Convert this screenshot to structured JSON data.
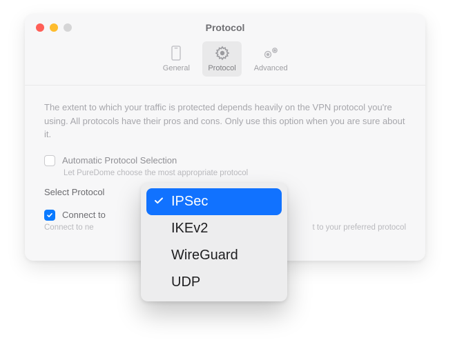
{
  "window": {
    "title": "Protocol"
  },
  "toolbar": {
    "items": [
      {
        "label": "General"
      },
      {
        "label": "Protocol"
      },
      {
        "label": "Advanced"
      }
    ],
    "selectedIndex": 1
  },
  "content": {
    "description": "The extent to which your traffic is protected depends heavily on the VPN protocol you're using. All protocols have their pros and cons. Only use this option when you are sure about it.",
    "autoProtocol": {
      "label": "Automatic Protocol Selection",
      "hint": "Let PureDome choose the most appropriate protocol",
      "checked": false
    },
    "selectLabel": "Select Protocol",
    "connectFallback": {
      "label": "Connect to",
      "hint_left": "Connect to ne",
      "hint_right": "t to your preferred protocol",
      "checked": true
    }
  },
  "dropdown": {
    "options": [
      {
        "label": "IPSec"
      },
      {
        "label": "IKEv2"
      },
      {
        "label": "WireGuard"
      },
      {
        "label": "UDP"
      }
    ],
    "selectedIndex": 0
  }
}
